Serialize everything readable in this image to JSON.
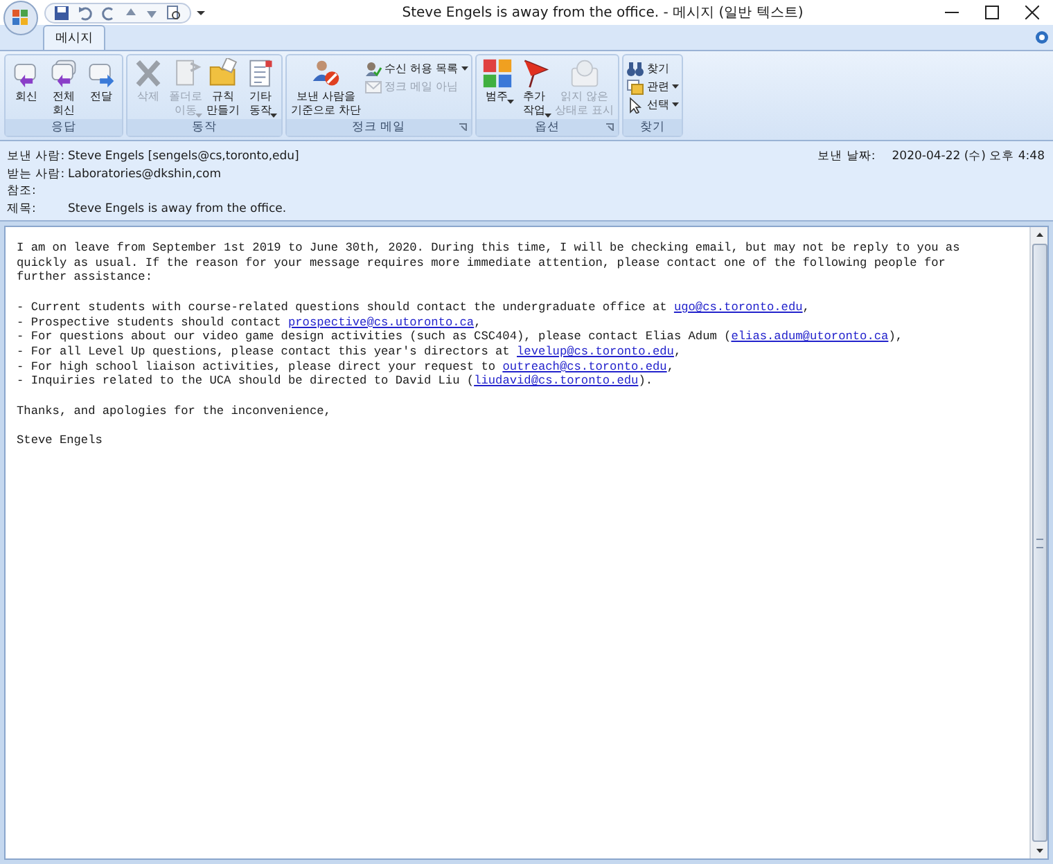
{
  "window": {
    "title": "Steve Engels is away from the office. - 메시지 (일반 텍스트)"
  },
  "tabs": [
    {
      "label": "메시지",
      "selected": true
    }
  ],
  "ribbon": [
    {
      "label": "응답",
      "launcher": false,
      "buttons": [
        {
          "kind": "large",
          "label": "회신",
          "disabled": false,
          "dropdown": false
        },
        {
          "kind": "large",
          "label": "전체\n회신",
          "disabled": false,
          "dropdown": false
        },
        {
          "kind": "large",
          "label": "전달",
          "disabled": false,
          "dropdown": false
        }
      ]
    },
    {
      "label": "동작",
      "launcher": false,
      "buttons": [
        {
          "kind": "large",
          "label": "삭제",
          "disabled": true,
          "dropdown": false
        },
        {
          "kind": "large",
          "label": "폴더로\n이동",
          "disabled": true,
          "dropdown": true
        },
        {
          "kind": "large",
          "label": "규칙\n만들기",
          "disabled": false,
          "dropdown": false
        },
        {
          "kind": "large",
          "label": "기타\n동작",
          "disabled": false,
          "dropdown": true
        }
      ]
    },
    {
      "label": "정크 메일",
      "launcher": true,
      "buttons": [
        {
          "kind": "large",
          "label": "보낸 사람을\n기준으로 차단",
          "disabled": false,
          "dropdown": false
        },
        {
          "kind": "small",
          "label": "수신 허용 목록",
          "disabled": false,
          "dropdown": true
        },
        {
          "kind": "small",
          "label": "정크 메일 아님",
          "disabled": true,
          "dropdown": false
        }
      ]
    },
    {
      "label": "옵션",
      "launcher": true,
      "buttons": [
        {
          "kind": "large",
          "label": "범주",
          "disabled": false,
          "dropdown": true
        },
        {
          "kind": "large",
          "label": "추가\n작업",
          "disabled": false,
          "dropdown": true
        },
        {
          "kind": "large",
          "label": "읽지 않은\n상태로 표시",
          "disabled": true,
          "dropdown": false
        }
      ]
    },
    {
      "label": "찾기",
      "launcher": false,
      "buttons": [
        {
          "kind": "small",
          "label": "찾기",
          "disabled": false,
          "dropdown": false
        },
        {
          "kind": "small",
          "label": "관련",
          "disabled": false,
          "dropdown": true
        },
        {
          "kind": "small",
          "label": "선택",
          "disabled": false,
          "dropdown": true
        }
      ]
    }
  ],
  "header": {
    "fields": [
      {
        "label": "보낸 사람:",
        "value": "Steve Engels [sengels@cs,toronto,edu]"
      },
      {
        "label": "받는 사람:",
        "value": "Laboratories@dkshin,com"
      },
      {
        "label": "참조:"
      },
      {
        "label": "제목:",
        "value": "Steve Engels is away from the office."
      }
    ],
    "sent": {
      "label": "보낸 날짜:",
      "value": "2020-04-22 (수) 오후 4:48"
    }
  },
  "body": [
    [
      [
        {
          "text": "I am on leave from September 1st 2019 to June 30th, 2020. During this time, I will be checking email, but may not be reply to you as"
        }
      ],
      [
        {
          "text": "quickly as usual. If the reason for your message requires more immediate attention, please contact one of the following people for"
        }
      ],
      [
        {
          "text": "further assistance:"
        }
      ]
    ],
    [
      [
        {
          "text": "- Current students with course-related questions should contact the undergraduate office at "
        },
        {
          "text": "ugo@cs.toronto.edu",
          "link": true
        },
        {
          "text": ","
        }
      ],
      [
        {
          "text": "- Prospective students should contact "
        },
        {
          "text": "prospective@cs.utoronto.ca",
          "link": true
        },
        {
          "text": ","
        }
      ],
      [
        {
          "text": "- For questions about our video game design activities (such as CSC404), please contact Elias Adum ("
        },
        {
          "text": "elias.adum@utoronto.ca",
          "link": true
        },
        {
          "text": "),"
        }
      ],
      [
        {
          "text": "- For all Level Up questions, please contact this year's directors at "
        },
        {
          "text": "levelup@cs.toronto.edu",
          "link": true
        },
        {
          "text": ","
        }
      ],
      [
        {
          "text": "- For high school liaison activities, please direct your request to "
        },
        {
          "text": "outreach@cs.toronto.edu",
          "link": true
        },
        {
          "text": ","
        }
      ],
      [
        {
          "text": "- Inquiries related to the UCA should be directed to David Liu ("
        },
        {
          "text": "liudavid@cs.toronto.edu",
          "link": true
        },
        {
          "text": ")."
        }
      ]
    ],
    [
      [
        {
          "text": "Thanks, and apologies for the inconvenience,"
        }
      ]
    ],
    [
      [
        {
          "text": "Steve Engels"
        }
      ]
    ]
  ]
}
